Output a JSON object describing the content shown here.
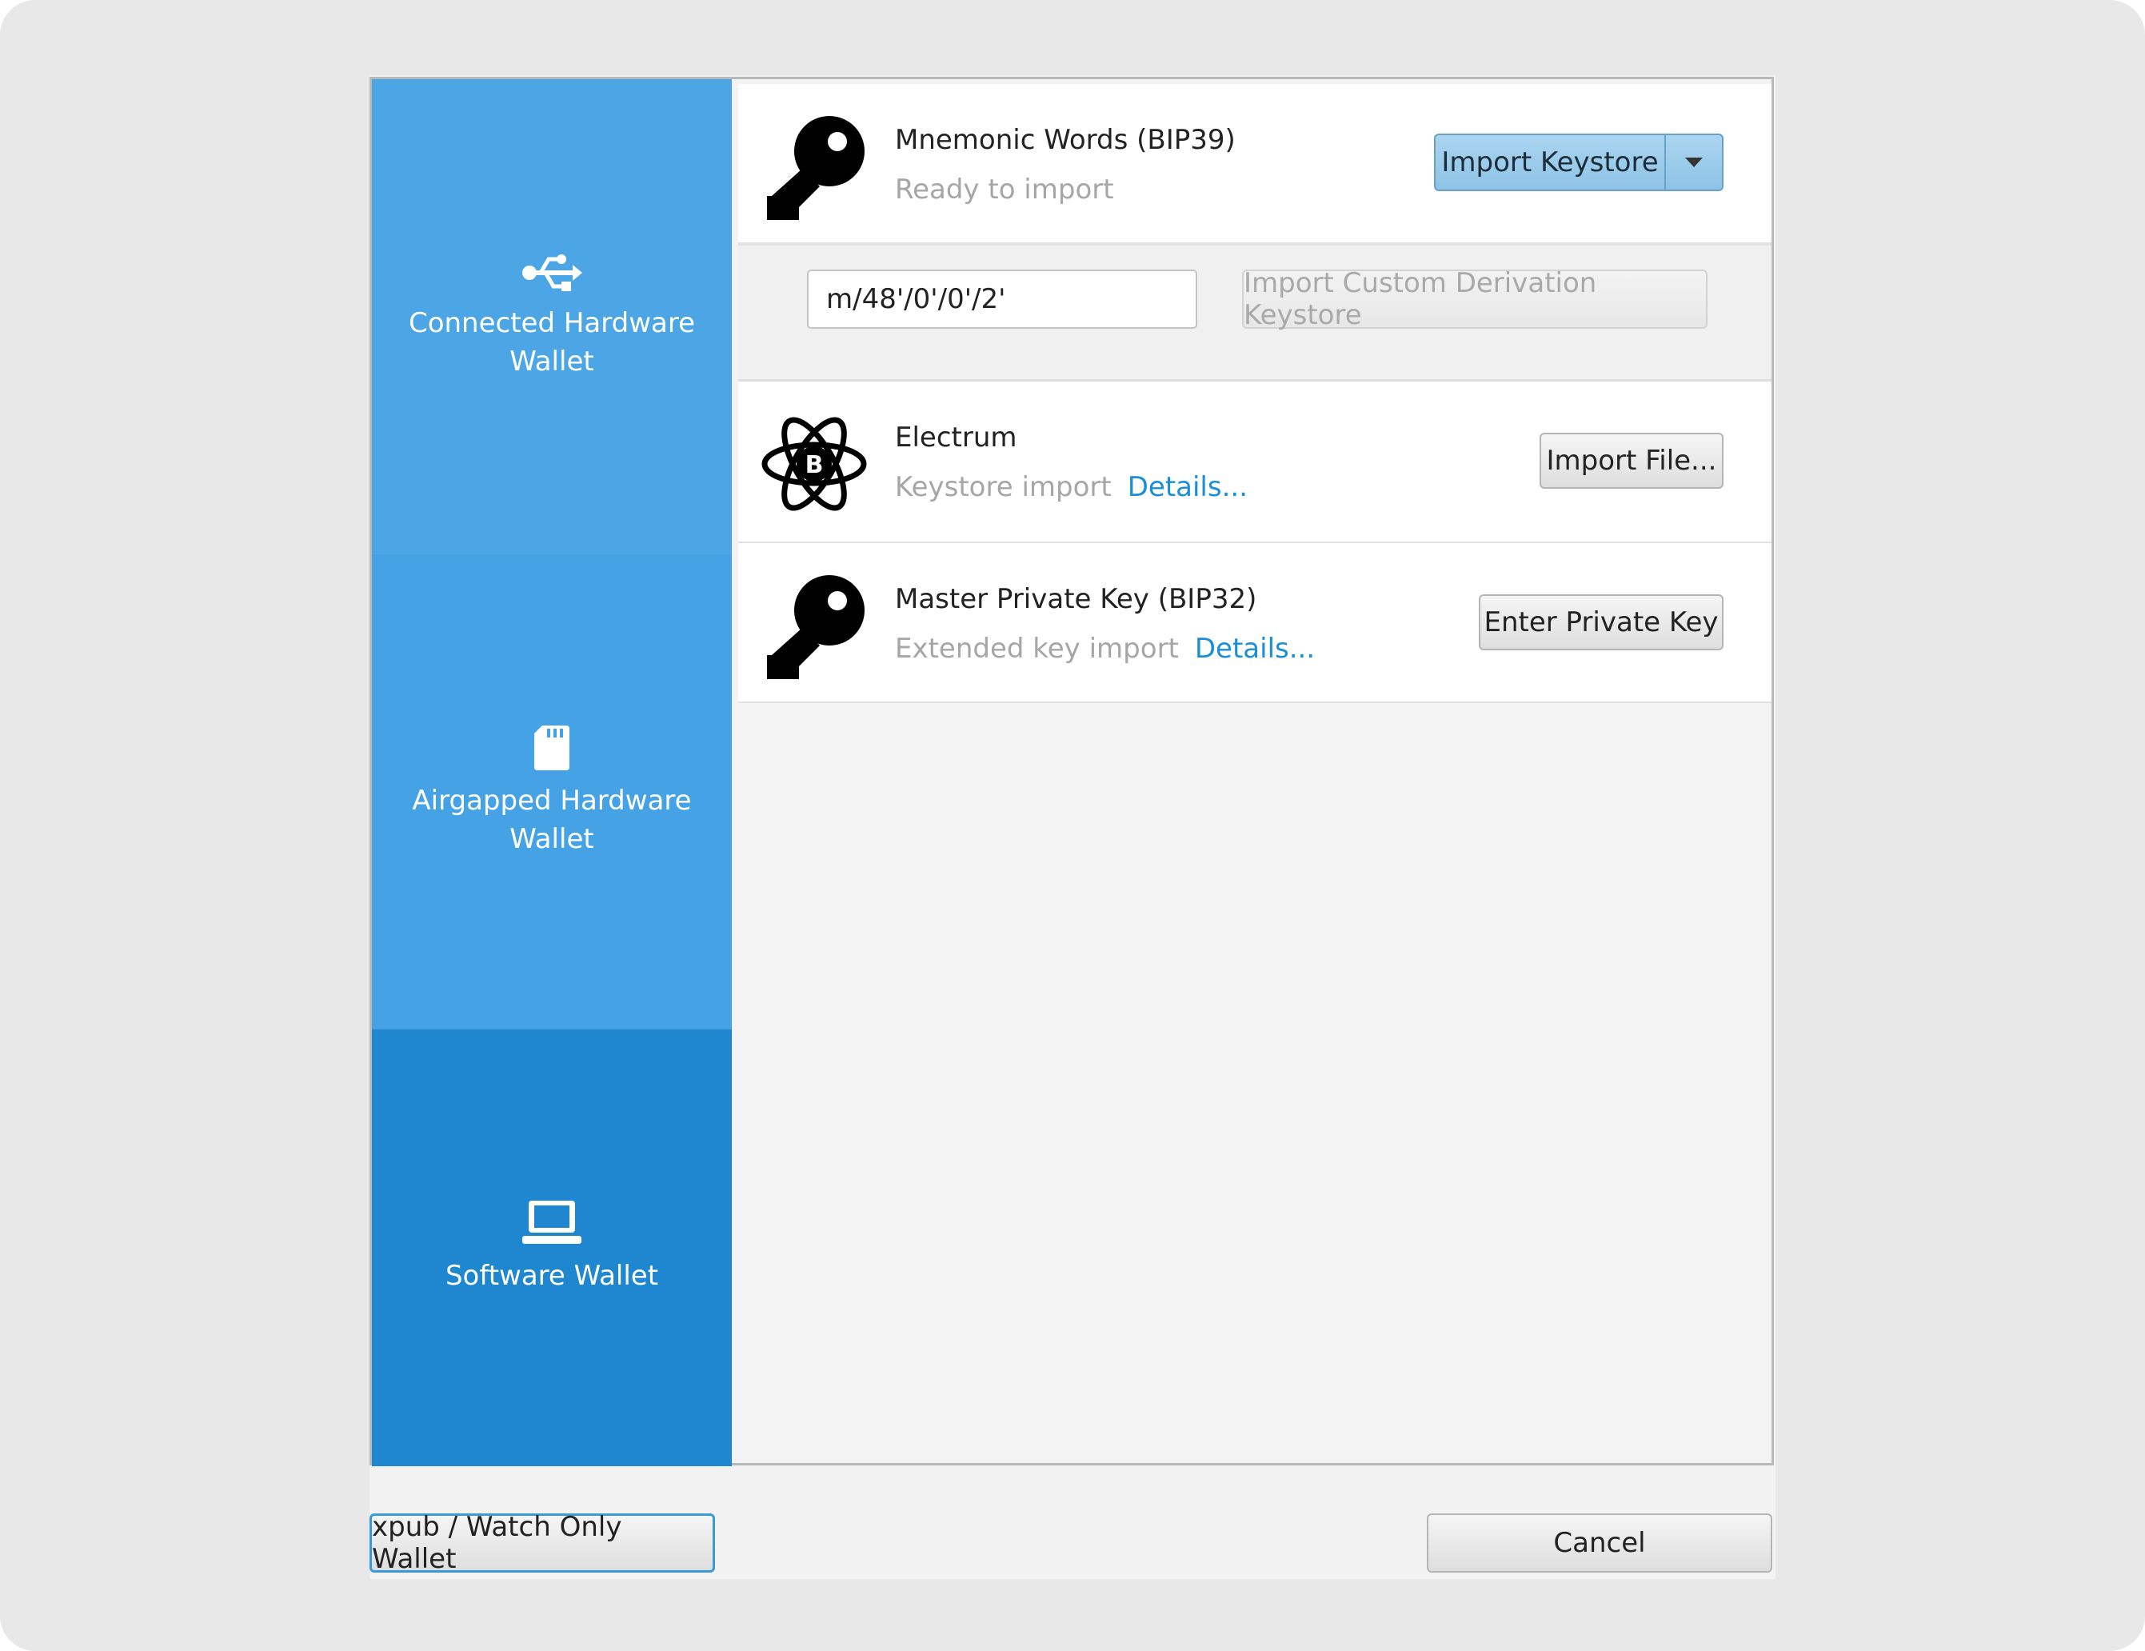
{
  "sidebar": {
    "items": [
      {
        "label": "Connected Hardware Wallet",
        "icon": "usb-icon"
      },
      {
        "label": "Airgapped Hardware Wallet",
        "icon": "sd-card-icon"
      },
      {
        "label": "Software Wallet",
        "icon": "laptop-icon",
        "selected": true
      }
    ]
  },
  "options": [
    {
      "title": "Mnemonic Words (BIP39)",
      "subtitle": "Ready to import",
      "link": "",
      "button": "Import Keystore",
      "icon": "key-icon"
    },
    {
      "title": "Electrum",
      "subtitle": "Keystore import",
      "link": "Details...",
      "button": "Import File...",
      "icon": "electrum-bitcoin-icon"
    },
    {
      "title": "Master Private Key (BIP32)",
      "subtitle": "Extended key import",
      "link": "Details...",
      "button": "Enter Private Key",
      "icon": "key-icon"
    }
  ],
  "derivation": {
    "value": "m/48'/0'/0'/2'",
    "button": "Import Custom Derivation Keystore"
  },
  "footer": {
    "watch_only": "xpub / Watch Only Wallet",
    "cancel": "Cancel"
  },
  "colors": {
    "sidebar_top": "#4ca6e5",
    "sidebar_selected": "#1f87cf",
    "link": "#1a8ed6",
    "split_button": "#9ccdec"
  }
}
